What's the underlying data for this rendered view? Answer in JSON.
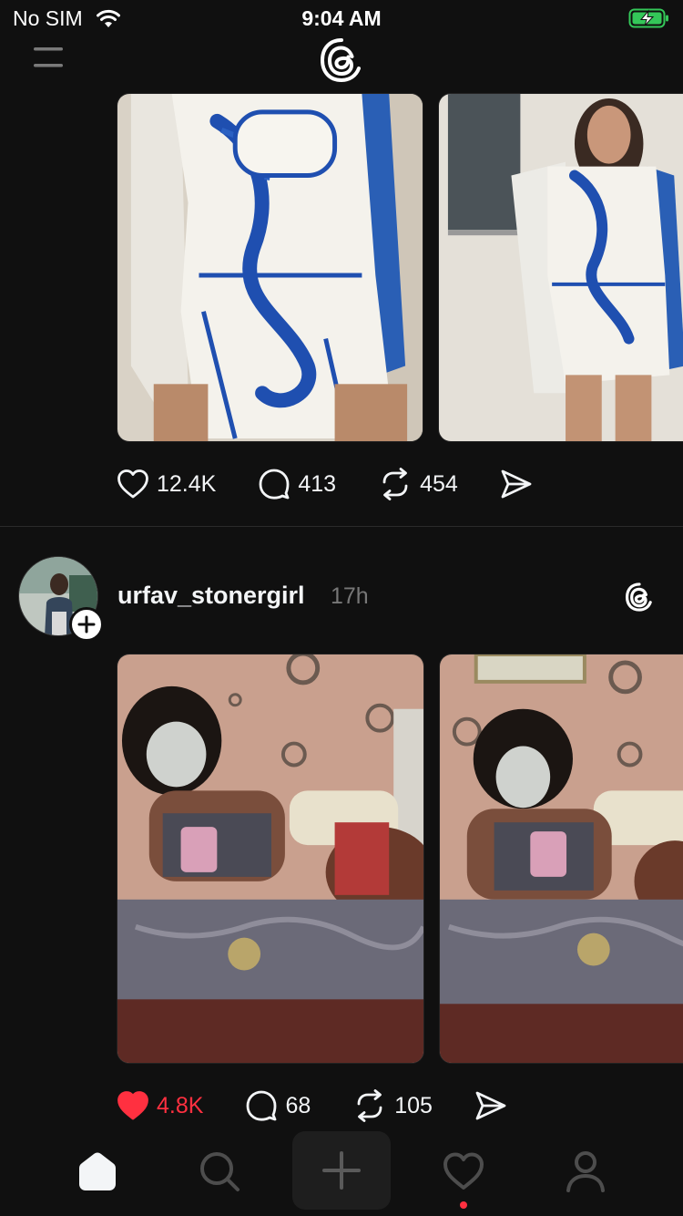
{
  "status_bar": {
    "carrier": "No SIM",
    "time": "9:04 AM",
    "wifi_icon": "wifi-icon",
    "battery_icon": "battery-charging-icon",
    "battery_color": "#34c759"
  },
  "header": {
    "menu_icon": "menu-icon",
    "logo_icon": "threads-logo-icon"
  },
  "posts": [
    {
      "images": [
        "dress-photo-closeup",
        "dress-photo-full"
      ],
      "likes": "12.4K",
      "replies": "413",
      "reposts": "454",
      "liked": false
    },
    {
      "username": "urfav_stonergirl",
      "time": "17h",
      "images": [
        "selfie-photo-1",
        "selfie-photo-2"
      ],
      "likes": "4.8K",
      "replies": "68",
      "reposts": "105",
      "liked": true
    }
  ],
  "tab_bar": {
    "items": [
      "home-icon",
      "search-icon",
      "create-icon",
      "activity-icon",
      "profile-icon"
    ],
    "active": "home-icon",
    "notification_dot_color": "#ff3040"
  },
  "colors": {
    "background": "#101010",
    "text": "#f3f5f7",
    "muted": "#777777",
    "like": "#ff3040"
  }
}
